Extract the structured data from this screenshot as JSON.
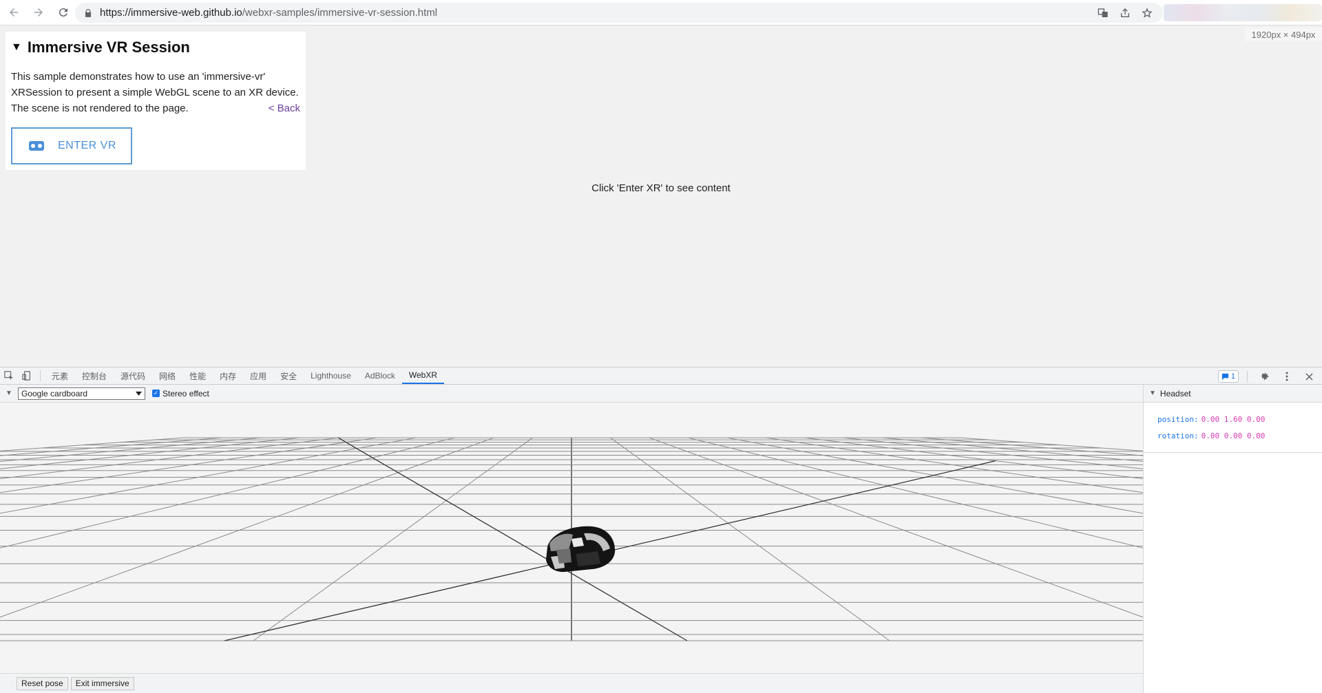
{
  "browser": {
    "url_host": "https://immersive-web.github.io",
    "url_path": "/webxr-samples/immersive-vr-session.html"
  },
  "viewport_label": "1920px × 494px",
  "sample": {
    "title": "Immersive VR Session",
    "description": "This sample demonstrates how to use an 'immersive-vr' XRSession to present a simple WebGL scene to an XR device. The scene is not rendered to the page.",
    "back_label": "< Back",
    "enter_vr_label": "ENTER VR",
    "center_message": "Click 'Enter XR' to see content"
  },
  "devtools": {
    "tabs": [
      "元素",
      "控制台",
      "源代码",
      "网络",
      "性能",
      "内存",
      "应用",
      "安全",
      "Lighthouse",
      "AdBlock",
      "WebXR"
    ],
    "active_tab": "WebXR",
    "issues_count": "1",
    "device_select": "Google cardboard",
    "stereo_label": "Stereo effect",
    "stereo_checked": true,
    "reset_pose_label": "Reset pose",
    "exit_immersive_label": "Exit immersive",
    "side_header": "Headset",
    "position_key": "position:",
    "position_value": "0.00 1.60 0.00",
    "rotation_key": "rotation:",
    "rotation_value": "0.00 0.00 0.00"
  },
  "colors": {
    "accent": "#1a73e8",
    "enter_vr_border": "#5b9bd5",
    "value_magenta": "#d63ab3"
  }
}
